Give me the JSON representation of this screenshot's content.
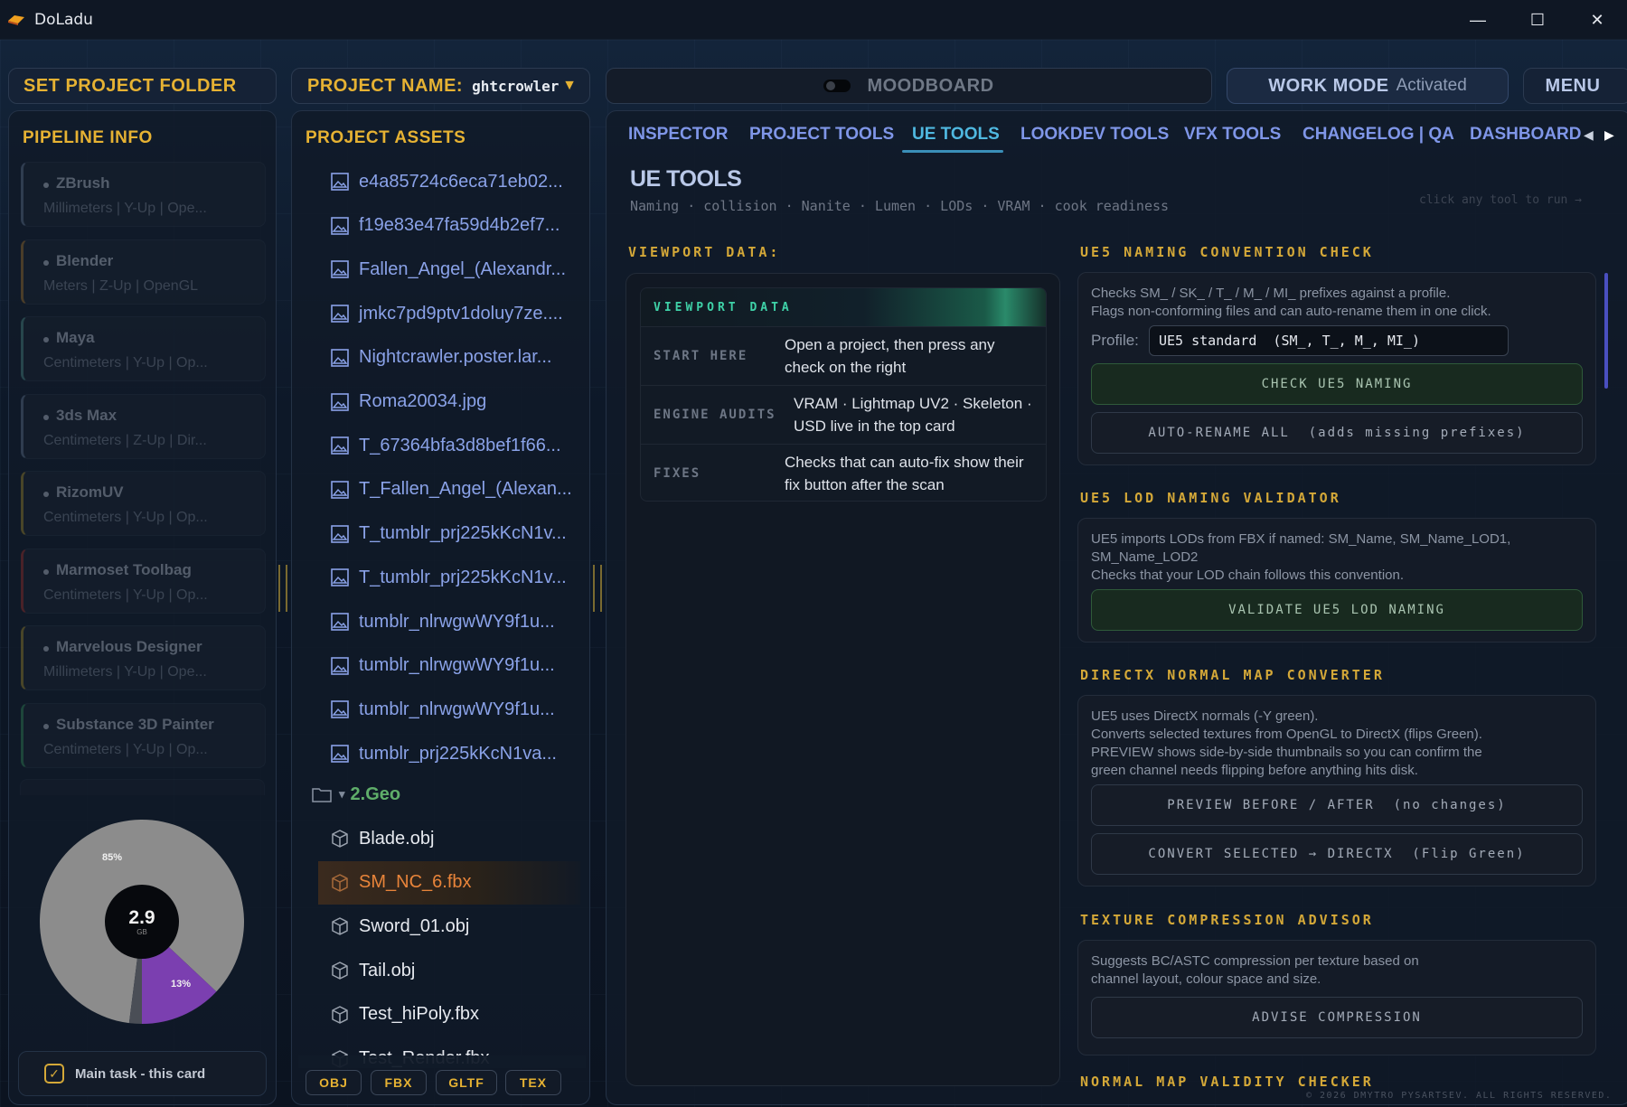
{
  "window": {
    "title": "DoLadu",
    "minimize": "—",
    "maximize": "☐",
    "close": "✕"
  },
  "header": {
    "set_project_folder": "SET PROJECT FOLDER",
    "project_name_label": "PROJECT NAME:",
    "project_name_value": "ghtcrowler",
    "project_dropdown_arrow": "▼",
    "moodboard": "MOODBOARD",
    "work_mode_label": "WORK MODE",
    "work_mode_state": "Activated",
    "menu": "MENU"
  },
  "pipeline": {
    "title": "PIPELINE INFO",
    "apps": [
      {
        "name": "ZBrush",
        "meta": "Millimeters  |  Y-Up  |  Ope..."
      },
      {
        "name": "Blender",
        "meta": "Meters  |  Z-Up  |  OpenGL"
      },
      {
        "name": "Maya",
        "meta": "Centimeters  |  Y-Up  |  Op..."
      },
      {
        "name": "3ds Max",
        "meta": "Centimeters  |  Z-Up  |  Dir..."
      },
      {
        "name": "RizomUV",
        "meta": "Centimeters  |  Y-Up  |  Op..."
      },
      {
        "name": "Marmoset Toolbag",
        "meta": "Centimeters  |  Y-Up  |  Op..."
      },
      {
        "name": "Marvelous Designer",
        "meta": "Millimeters  |  Y-Up  |  Ope..."
      },
      {
        "name": "Substance 3D Painter",
        "meta": "Centimeters  |  Y-Up  |  Op..."
      }
    ],
    "accent_colors": [
      "#4a5a70",
      "#7a5a2a",
      "#3a6a6a",
      "#4a5a70",
      "#7a6a2a",
      "#7a2a2a",
      "#7a6a2a",
      "#2a6a4a"
    ],
    "storage": {
      "total": "2.9",
      "unit": "GB",
      "slices": [
        {
          "label": "85%",
          "value": 85,
          "color": "#8c8c8c"
        },
        {
          "label": "13%",
          "value": 13,
          "color": "#7b3fb0"
        },
        {
          "label": "",
          "value": 2,
          "color": "#4a4e56"
        }
      ]
    },
    "main_task": "Main task - this card"
  },
  "assets": {
    "title": "PROJECT ASSETS",
    "images": [
      "e4a85724c6eca71eb02...",
      "f19e83e47fa59d4b2ef7...",
      "Fallen_Angel_(Alexandr...",
      "jmkc7pd9ptv1doluy7ze....",
      "Nightcrawler.poster.lar...",
      "Roma20034.jpg",
      "T_67364bfa3d8bef1f66...",
      "T_Fallen_Angel_(Alexan...",
      "T_tumblr_prj225kKcN1v...",
      "T_tumblr_prj225kKcN1v...",
      "tumblr_nlrwgwWY9f1u...",
      "tumblr_nlrwgwWY9f1u...",
      "tumblr_nlrwgwWY9f1u...",
      "tumblr_prj225kKcN1va..."
    ],
    "folder": "2.Geo",
    "folder_arrow": "▾",
    "geo_files": [
      "Blade.obj",
      "SM_NC_6.fbx",
      "Sword_01.obj",
      "Tail.obj",
      "Test_hiPoly.fbx",
      "Test_Render.fbx"
    ],
    "selected_index": 1,
    "formats": [
      "OBJ",
      "FBX",
      "GLTF",
      "TEX"
    ]
  },
  "tabs": {
    "items": [
      "INSPECTOR",
      "PROJECT TOOLS",
      "UE TOOLS",
      "LOOKDEV TOOLS",
      "VFX TOOLS",
      "CHANGELOG | QA",
      "DASHBOARD"
    ],
    "active_index": 2,
    "prev": "◀",
    "next": "▶"
  },
  "ue": {
    "title": "UE TOOLS",
    "subtitle": "Naming · collision · Nanite · Lumen · LODs · VRAM · cook readiness",
    "hint": "click any tool to run →",
    "viewport_heading": "VIEWPORT DATA:",
    "viewport_card_title": "VIEWPORT DATA",
    "viewport_rows": [
      {
        "key": "START HERE",
        "value": "Open a project, then press any check on the right"
      },
      {
        "key": "ENGINE AUDITS",
        "value": "VRAM · Lightmap UV2 · Skeleton · USD live in the top card"
      },
      {
        "key": "FIXES",
        "value": "Checks that can auto-fix show their fix button after the scan"
      }
    ],
    "naming": {
      "heading": "UE5 NAMING CONVENTION CHECK",
      "desc1": "Checks SM_ / SK_ / T_ / M_ / MI_ prefixes against a profile.",
      "desc2": "Flags non-conforming files and can auto-rename them in one click.",
      "profile_label": "Profile:",
      "profile_value": "UE5 standard  (SM_, T_, M_, MI_)",
      "check_btn": "CHECK UE5 NAMING",
      "rename_btn": "AUTO-RENAME ALL  (adds missing prefixes)"
    },
    "lod": {
      "heading": "UE5 LOD NAMING VALIDATOR",
      "desc1": "UE5 imports LODs from FBX if named: SM_Name, SM_Name_LOD1,",
      "desc2": "SM_Name_LOD2",
      "desc3": "Checks that your LOD chain follows this convention.",
      "btn": "VALIDATE UE5 LOD NAMING"
    },
    "directx": {
      "heading": "DIRECTX NORMAL MAP CONVERTER",
      "desc1": "UE5 uses DirectX normals (-Y green).",
      "desc2": "Converts selected textures from OpenGL to DirectX (flips Green).",
      "desc3": "PREVIEW shows side-by-side thumbnails so you can confirm the",
      "desc4": "green channel needs flipping before anything hits disk.",
      "preview_btn": "PREVIEW BEFORE / AFTER  (no changes)",
      "convert_btn": "CONVERT SELECTED → DIRECTX  (Flip Green)"
    },
    "compression": {
      "heading": "TEXTURE COMPRESSION ADVISOR",
      "desc1": "Suggests BC/ASTC compression per texture based on",
      "desc2": "channel layout, colour space and size.",
      "btn": "ADVISE COMPRESSION"
    },
    "normal_validity_heading": "NORMAL MAP VALIDITY CHECKER",
    "copyright": "© 2026 DMYTRO PYSARTSEV. ALL RIGHTS RESERVED."
  }
}
